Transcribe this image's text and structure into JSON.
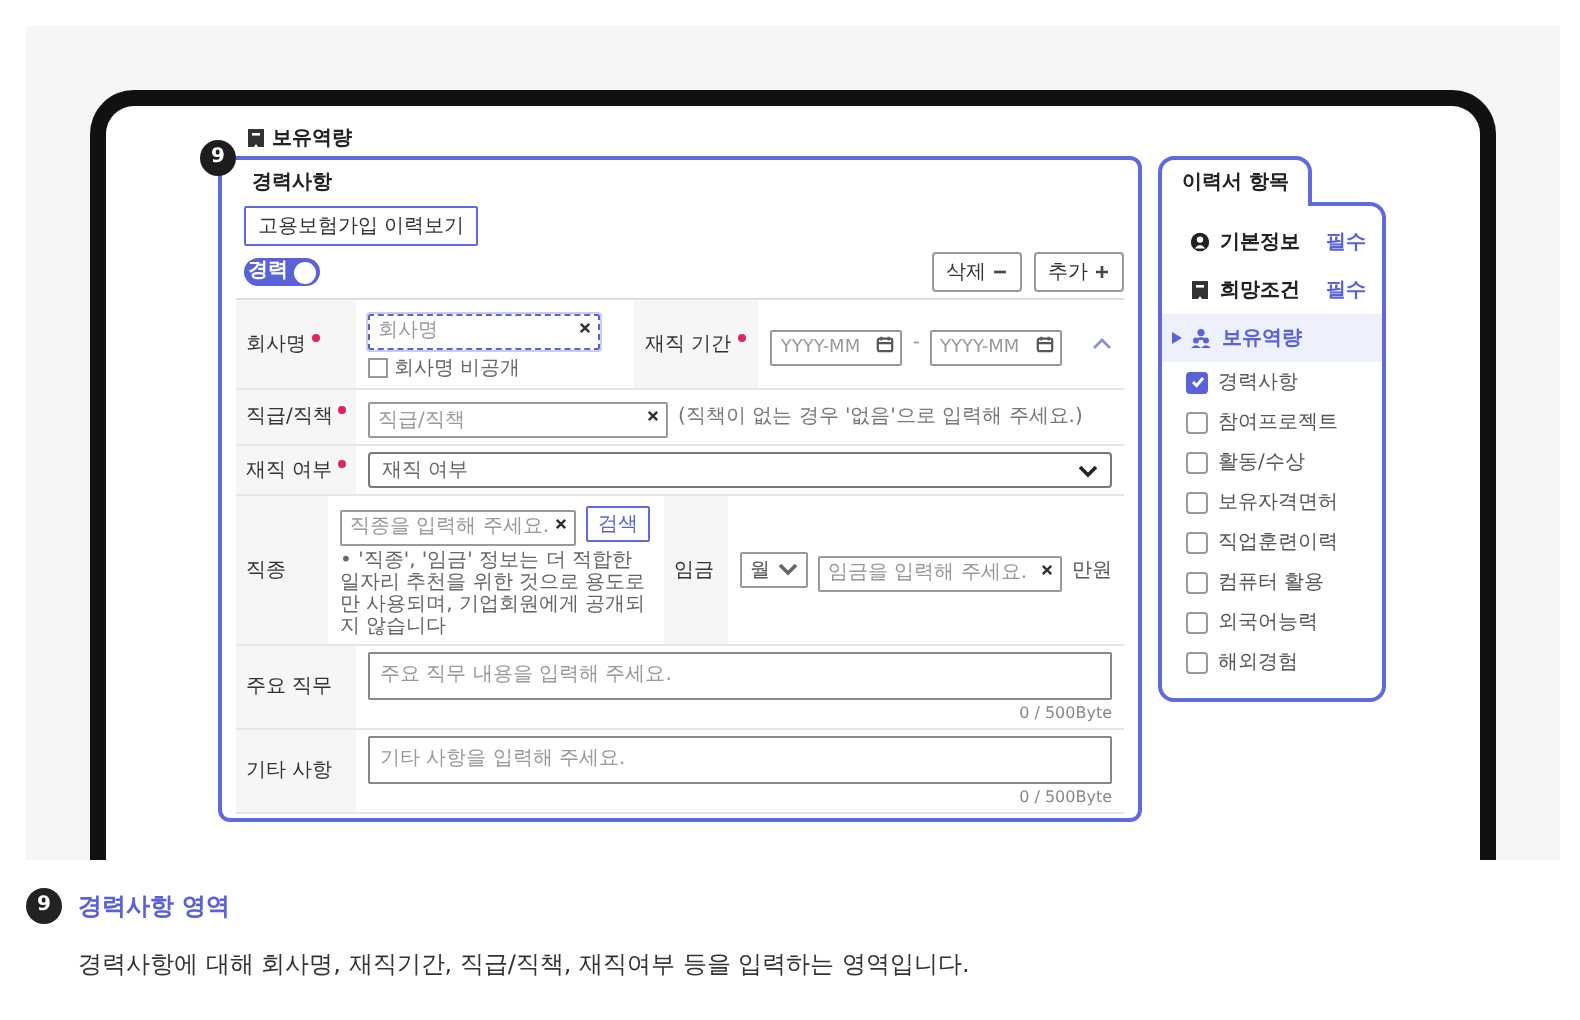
{
  "section_title": "보유역량",
  "form": {
    "badge": "9",
    "heading": "경력사항",
    "history_button": "고용보험가입 이력보기",
    "toggle": {
      "label": "경력",
      "on": true
    },
    "delete_button": "삭제",
    "add_button": "추가",
    "rows": [
      {
        "kind": "company",
        "label": "회사명",
        "required": true,
        "input": {
          "placeholder": "회사명",
          "focused": true
        },
        "checkbox": {
          "label": "회사명 비공개",
          "checked": false
        },
        "period": {
          "label": "재직 기간",
          "required": true,
          "start": {
            "placeholder": "YYYY-MM"
          },
          "separator": "-",
          "end": {
            "placeholder": "YYYY-MM"
          }
        }
      },
      {
        "kind": "text",
        "label": "직급/직책",
        "required": true,
        "input": {
          "placeholder": "직급/직책"
        },
        "hint": "(직책이 없는 경우 '없음'으로 입력해 주세요.)"
      },
      {
        "kind": "select",
        "label": "재직 여부",
        "required": true,
        "value": "재직 여부"
      },
      {
        "kind": "job",
        "label": "직종",
        "required": false,
        "input": {
          "placeholder": "직종을 입력해 주세요."
        },
        "search_button": "검색",
        "note": "• '직종', '임금' 정보는 더 적합한 일자리 추천을 위한 것으로 용도로만 사용되며, 기업회원에게 공개되지 않습니다",
        "salary": {
          "label": "임금",
          "period": "월",
          "input": {
            "placeholder": "임금을 입력해 주세요."
          },
          "unit": "만원"
        }
      },
      {
        "kind": "textarea",
        "label": "주요 직무",
        "required": false,
        "placeholder": "주요 직무 내용을 입력해 주세요.",
        "counter": "0 / 500Byte"
      },
      {
        "kind": "textarea",
        "label": "기타 사항",
        "required": false,
        "placeholder": "기타 사항을 입력해 주세요.",
        "counter": "0 / 500Byte"
      }
    ]
  },
  "nav": {
    "tab": "이력서 항목",
    "items": [
      {
        "label": "기본정보",
        "badge": "필수",
        "selected": false,
        "expanded": false
      },
      {
        "label": "희망조건",
        "badge": "필수",
        "selected": false,
        "expanded": false
      },
      {
        "label": "보유역량",
        "selected": true,
        "expanded": true,
        "children": [
          {
            "label": "경력사항",
            "checked": true
          },
          {
            "label": "참여프로젝트",
            "checked": false
          },
          {
            "label": "활동/수상",
            "checked": false
          },
          {
            "label": "보유자격면허",
            "checked": false
          },
          {
            "label": "직업훈련이력",
            "checked": false
          },
          {
            "label": "컴퓨터 활용",
            "checked": false
          },
          {
            "label": "외국어능력",
            "checked": false
          },
          {
            "label": "해외경험",
            "checked": false
          }
        ]
      }
    ]
  },
  "caption": {
    "badge": "9",
    "title": "경력사항 영역",
    "text": "경력사항에 대해 회사명, 재직기간, 직급/직책, 재직여부 등을 입력하는 영역입니다."
  }
}
